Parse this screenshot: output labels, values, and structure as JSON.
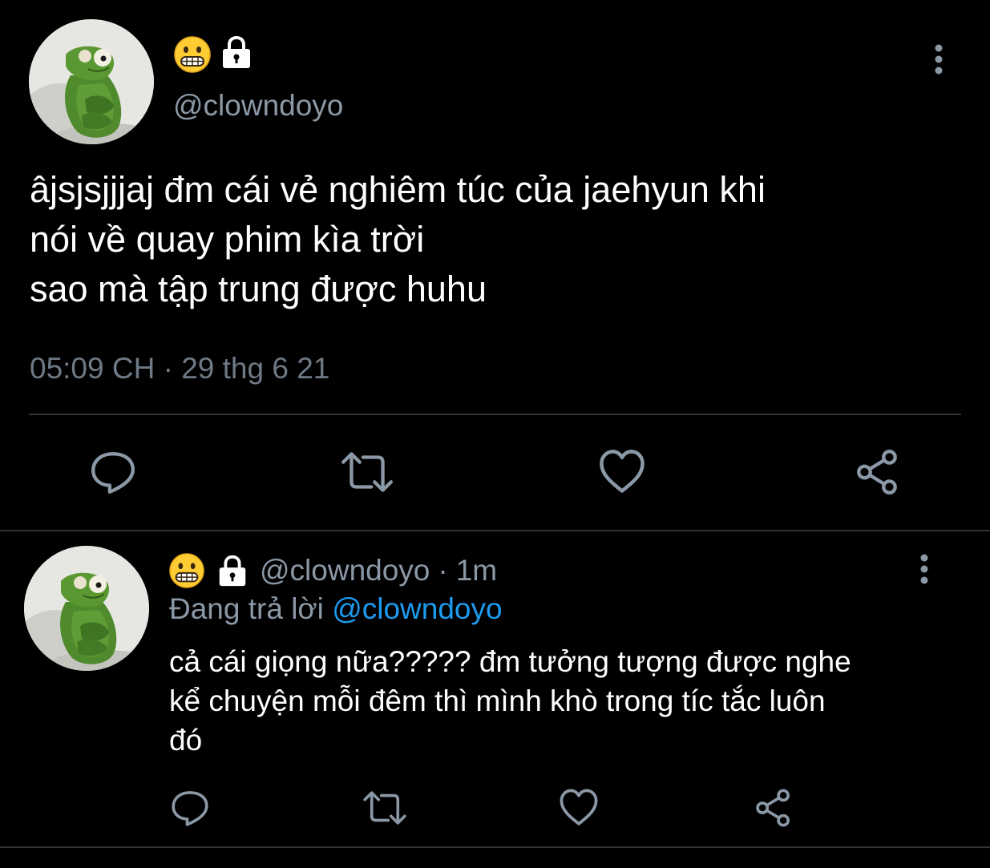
{
  "main_tweet": {
    "author": {
      "display_emoji": "grimacing-face-emoji",
      "locked_icon": "lock-icon",
      "handle": "@clowndoyo",
      "avatar": "kermit-plush-avatar"
    },
    "text_lines": [
      "âjsjsjjjaj đm cái vẻ nghiêm túc của jaehyun khi",
      "nói về quay phim kìa trời",
      "sao mà tập trung được huhu"
    ],
    "meta": "05:09 CH · 29 thg 6 21",
    "actions": [
      "reply-icon",
      "retweet-icon",
      "like-icon",
      "share-icon"
    ]
  },
  "reply_tweet": {
    "author": {
      "display_emoji": "grimacing-face-emoji",
      "locked_icon": "lock-icon",
      "handle": "@clowndoyo",
      "avatar": "kermit-plush-avatar"
    },
    "separator": "·",
    "time": "1m",
    "replying_to_label": "Đang trả lời",
    "replying_to_handle": "@clowndoyo",
    "text_lines": [
      "cả cái giọng nữa????? đm tưởng tượng được nghe",
      "kể chuyện mỗi đêm thì mình khò trong tíc tắc luôn",
      "đó"
    ],
    "actions": [
      "reply-icon",
      "retweet-icon",
      "like-icon",
      "share-icon"
    ]
  },
  "colors": {
    "background": "#000000",
    "text": "#ffffff",
    "secondary_text": "#8b98a5",
    "meta_text": "#6e7a86",
    "link": "#1d9bf0",
    "divider": "#2f3336",
    "icon": "#8b98a5"
  }
}
